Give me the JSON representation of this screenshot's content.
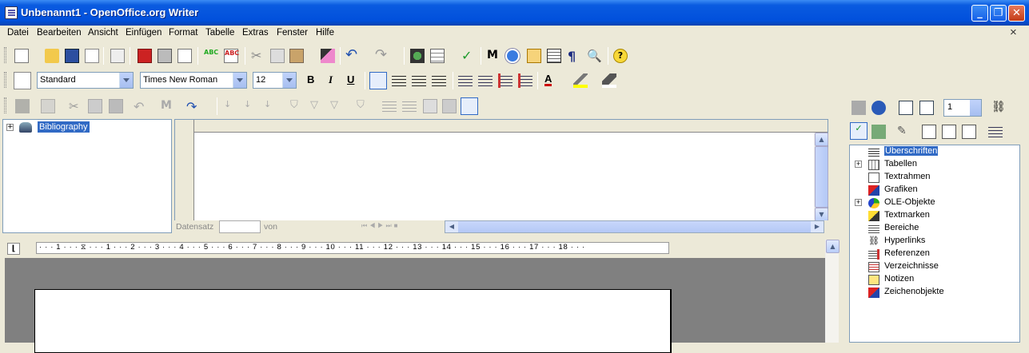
{
  "window": {
    "title": "Unbenannt1 - OpenOffice.org Writer"
  },
  "menu": {
    "items": [
      "Datei",
      "Bearbeiten",
      "Ansicht",
      "Einfügen",
      "Format",
      "Tabelle",
      "Extras",
      "Fenster",
      "Hilfe"
    ],
    "close_glyph": "×"
  },
  "formatting": {
    "style_value": "Standard",
    "font_value": "Times New Roman",
    "size_value": "12",
    "bold": "B",
    "italic": "I",
    "underline": "U",
    "font_color_letter": "A"
  },
  "datasource": {
    "tree_item": "Bibliography",
    "record_label": "Datensatz",
    "of_label": "von"
  },
  "ruler": {
    "marks": "· · · 1 · · · ⧖ · · · 1 · · · 2 · · · 3 · · · 4 · · · 5 · · · 6 · · · 7 · · · 8 · · · 9 · · · 10 · · · 11 · · · 12 · · · 13 · · · 14 · · · 15 · · · 16 · · · 17 · · · 18 · · ·"
  },
  "navigator": {
    "page_number": "1",
    "items": [
      {
        "label": "Überschriften",
        "expandable": false,
        "selected": true
      },
      {
        "label": "Tabellen",
        "expandable": true,
        "selected": false
      },
      {
        "label": "Textrahmen",
        "expandable": false,
        "selected": false
      },
      {
        "label": "Grafiken",
        "expandable": false,
        "selected": false
      },
      {
        "label": "OLE-Objekte",
        "expandable": true,
        "selected": false
      },
      {
        "label": "Textmarken",
        "expandable": false,
        "selected": false
      },
      {
        "label": "Bereiche",
        "expandable": false,
        "selected": false
      },
      {
        "label": "Hyperlinks",
        "expandable": false,
        "selected": false
      },
      {
        "label": "Referenzen",
        "expandable": false,
        "selected": false
      },
      {
        "label": "Verzeichnisse",
        "expandable": false,
        "selected": false
      },
      {
        "label": "Notizen",
        "expandable": false,
        "selected": false
      },
      {
        "label": "Zeichenobjekte",
        "expandable": false,
        "selected": false
      }
    ]
  },
  "colors": {
    "titlebar": "#0150DC",
    "selection": "#316AC5",
    "font_color": "#CC0000",
    "highlight": "#FFFF00"
  }
}
